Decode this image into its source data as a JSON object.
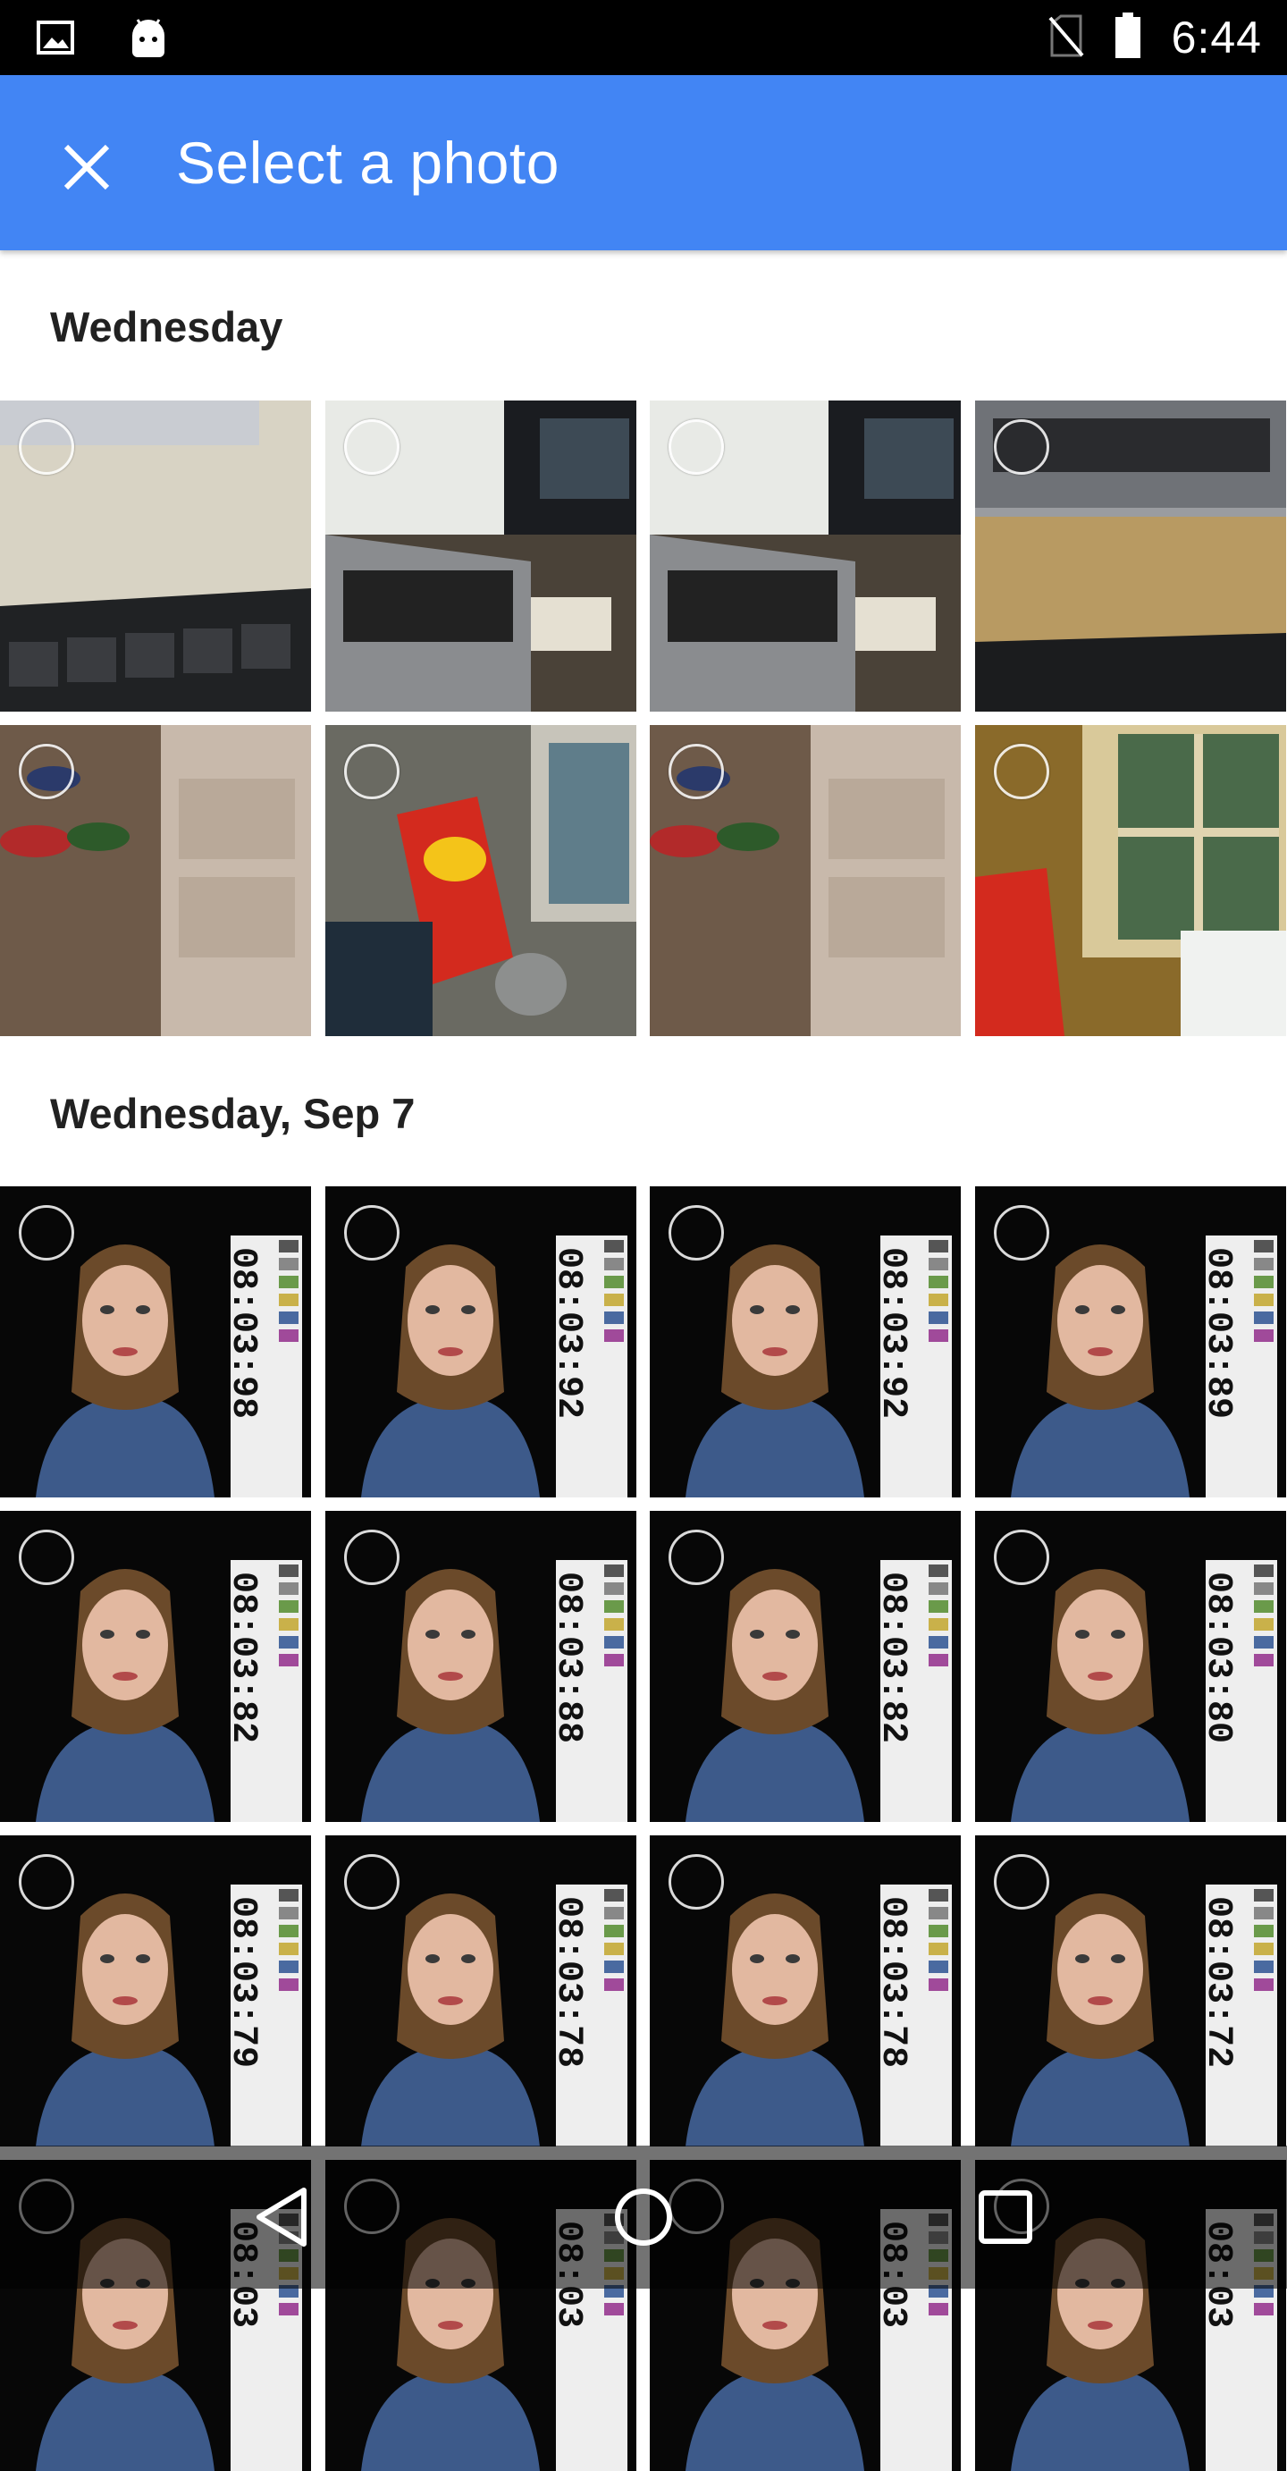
{
  "status_bar": {
    "time": "6:44",
    "icons": [
      "gallery-icon",
      "android-icon",
      "no-sim-icon",
      "battery-icon"
    ]
  },
  "app_bar": {
    "title": "Select a photo",
    "close_icon": "close-icon",
    "background_color": "#4285f4"
  },
  "sections": [
    {
      "label": "Wednesday",
      "photos": [
        {
          "scene": "keyboard-desk",
          "selected": false
        },
        {
          "scene": "laptop-monitor",
          "selected": false
        },
        {
          "scene": "laptop-monitor-2",
          "selected": false
        },
        {
          "scene": "laptop-desk",
          "selected": false
        },
        {
          "scene": "shoes-drawers",
          "selected": false
        },
        {
          "scene": "chips-window",
          "selected": false
        },
        {
          "scene": "shoes-drawers-2",
          "selected": false
        },
        {
          "scene": "window-chips",
          "selected": false
        }
      ]
    },
    {
      "label": "Wednesday, Sep 7",
      "photos": [
        {
          "scene": "portrait",
          "timecode": "08:03:98",
          "selected": false
        },
        {
          "scene": "portrait",
          "timecode": "08:03:92",
          "selected": false
        },
        {
          "scene": "portrait",
          "timecode": "08:03:92",
          "selected": false
        },
        {
          "scene": "portrait",
          "timecode": "08:03:89",
          "selected": false
        },
        {
          "scene": "portrait",
          "timecode": "08:03:82",
          "selected": false
        },
        {
          "scene": "portrait",
          "timecode": "08:03:88",
          "selected": false
        },
        {
          "scene": "portrait",
          "timecode": "08:03:82",
          "selected": false
        },
        {
          "scene": "portrait",
          "timecode": "08:03:80",
          "selected": false
        },
        {
          "scene": "portrait",
          "timecode": "08:03:79",
          "selected": false
        },
        {
          "scene": "portrait",
          "timecode": "08:03:78",
          "selected": false
        },
        {
          "scene": "portrait",
          "timecode": "08:03:78",
          "selected": false
        },
        {
          "scene": "portrait",
          "timecode": "08:03:72",
          "selected": false
        },
        {
          "scene": "portrait",
          "timecode": "08:03",
          "selected": false
        },
        {
          "scene": "portrait",
          "timecode": "08:03",
          "selected": false
        },
        {
          "scene": "portrait",
          "timecode": "08:03",
          "selected": false
        },
        {
          "scene": "portrait",
          "timecode": "08:03",
          "selected": false
        }
      ]
    }
  ],
  "nav_bar": {
    "buttons": [
      "back-icon",
      "home-icon",
      "recents-icon"
    ]
  }
}
